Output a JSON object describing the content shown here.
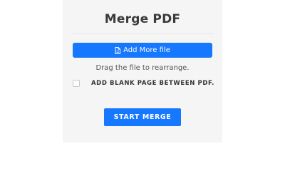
{
  "page": {
    "title": "Merge PDF"
  },
  "actions": {
    "add_file_label": "Add More file",
    "add_file_icon": "file-icon",
    "hint": "Drag the file to rearrange.",
    "blank_page_label": "ADD BLANK PAGE BETWEEN PDF.",
    "blank_page_checked": false,
    "start_label": "START MERGE"
  },
  "colors": {
    "primary": "#1677ff",
    "panel_background": "#f5f5f5"
  }
}
